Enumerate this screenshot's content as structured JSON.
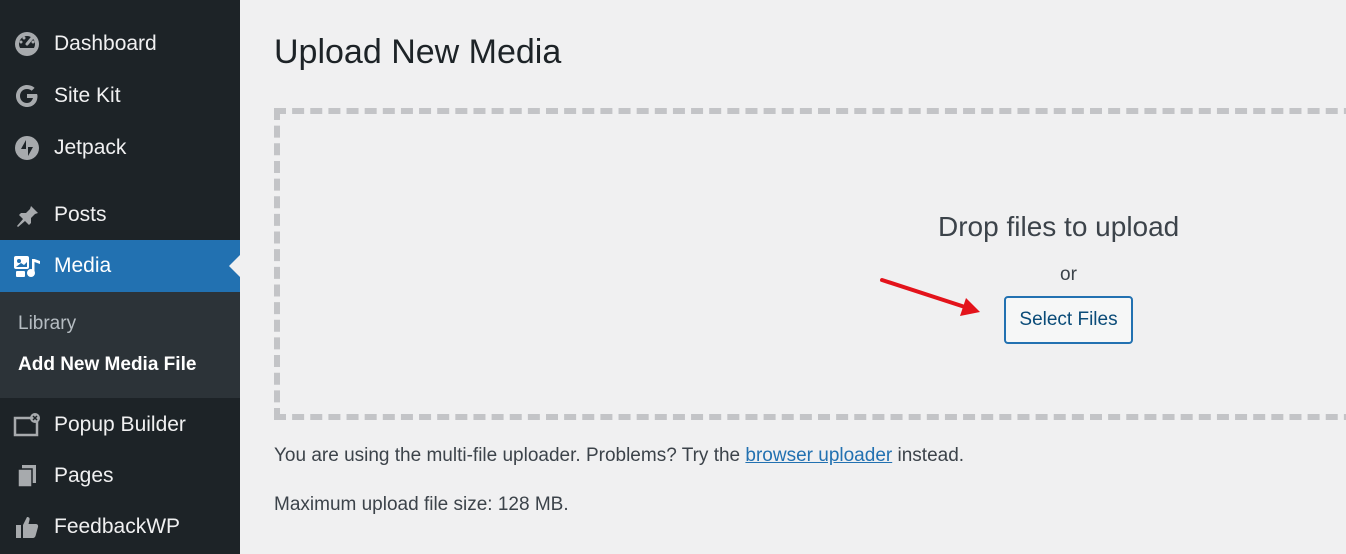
{
  "sidebar": {
    "items": [
      {
        "label": "Dashboard",
        "icon": "dashboard-icon"
      },
      {
        "label": "Site Kit",
        "icon": "google-g-icon"
      },
      {
        "label": "Jetpack",
        "icon": "jetpack-bolt-icon"
      },
      {
        "label": "Posts",
        "icon": "pushpin-icon"
      },
      {
        "label": "Media",
        "icon": "media-icon"
      },
      {
        "label": "Popup Builder",
        "icon": "popup-window-icon"
      },
      {
        "label": "Pages",
        "icon": "pages-icon"
      },
      {
        "label": "FeedbackWP",
        "icon": "thumbs-up-icon"
      }
    ],
    "submenu": [
      {
        "label": "Library"
      },
      {
        "label": "Add New Media File"
      }
    ]
  },
  "main": {
    "title": "Upload New Media",
    "drop_text": "Drop files to upload",
    "or_text": "or",
    "select_button": "Select Files",
    "info_before": "You are using the multi-file uploader. Problems? Try the ",
    "info_link": "browser uploader",
    "info_after": " instead.",
    "max_size": "Maximum upload file size: 128 MB."
  },
  "colors": {
    "sidebar_bg": "#1d2327",
    "active_bg": "#2271b1",
    "submenu_bg": "#2c3338",
    "page_bg": "#f0f0f1",
    "arrow": "#e3131b"
  }
}
